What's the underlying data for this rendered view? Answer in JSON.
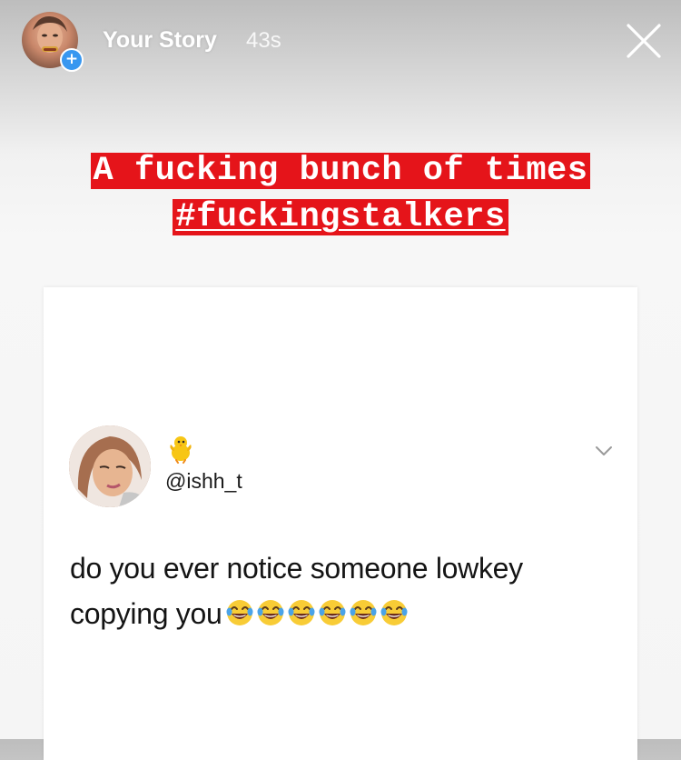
{
  "story": {
    "user_label": "Your Story",
    "elapsed": "43s",
    "close_icon": "close-icon",
    "add_badge": "+"
  },
  "caption": {
    "line1": "A fucking bunch of times",
    "line2": "#fuckingstalkers",
    "highlight_color": "#e5141a"
  },
  "tweet": {
    "badge_icon": "baby-chick-icon",
    "handle": "@ishh_t",
    "text": "do you ever notice someone lowkey copying you",
    "emoji_icon": "laughing-tears-emoji",
    "emoji_count": 6,
    "menu_icon": "chevron-down-icon"
  }
}
